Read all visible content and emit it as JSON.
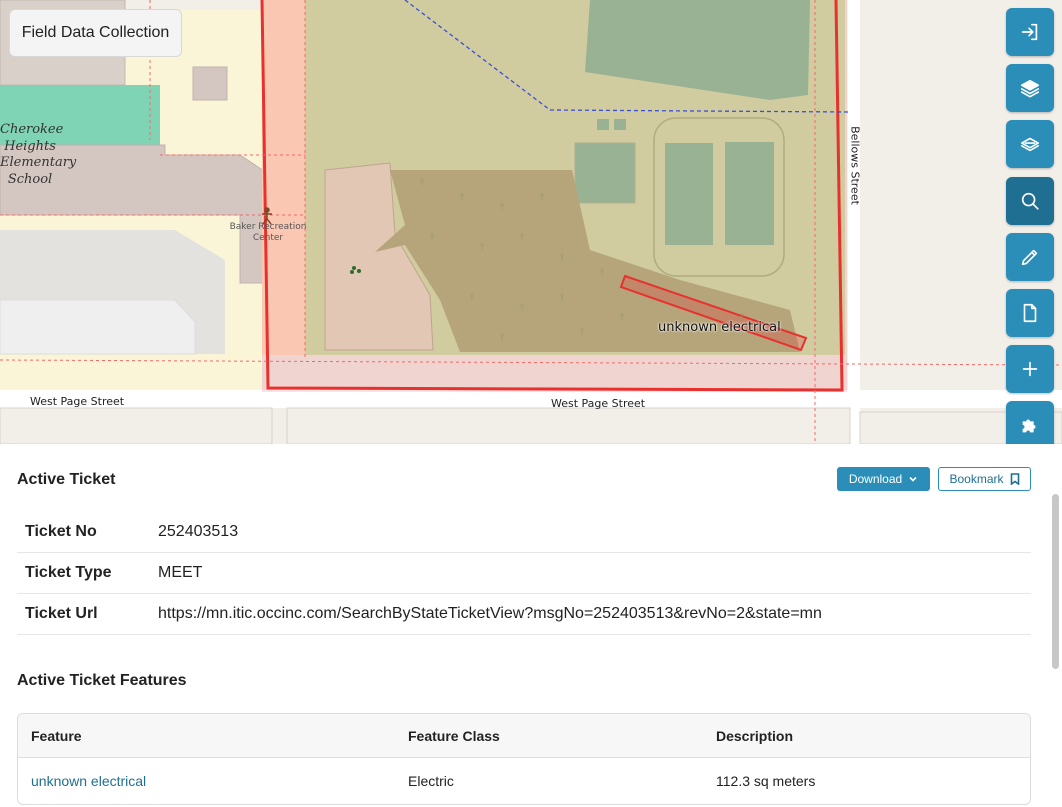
{
  "app": {
    "title": "Field Data Collection"
  },
  "map": {
    "labels": {
      "school": "Cherokee Heights Elementary School",
      "school_lines": [
        "Cherokee",
        "Heights",
        "Elementary",
        "School"
      ],
      "baker": "Baker Recreation Center",
      "baker_lines": [
        "Baker Recreation",
        "Center"
      ],
      "west_page_1": "West Page Street",
      "west_page_2": "West Page Street",
      "bellows": "Bellows Street",
      "feature": "unknown electrical"
    },
    "toolbar": [
      {
        "name": "logout-button",
        "icon": "logout-icon"
      },
      {
        "name": "layers-button",
        "icon": "layers-icon"
      },
      {
        "name": "layers-outline-button",
        "icon": "layers-outline-icon"
      },
      {
        "name": "search-button",
        "icon": "search-icon",
        "active": true
      },
      {
        "name": "edit-button",
        "icon": "pencil-icon"
      },
      {
        "name": "document-button",
        "icon": "document-icon"
      },
      {
        "name": "add-button",
        "icon": "plus-icon"
      },
      {
        "name": "tools-button",
        "icon": "puzzle-icon"
      }
    ],
    "colors": {
      "ticket_boundary": "#e8312f",
      "park": "#cde5b3",
      "woods": "#aeb987",
      "water_feature": "#8cc8a3"
    }
  },
  "active_ticket": {
    "title": "Active Ticket",
    "download_label": "Download",
    "bookmark_label": "Bookmark",
    "rows": [
      {
        "key": "Ticket No",
        "value": "252403513"
      },
      {
        "key": "Ticket Type",
        "value": "MEET"
      },
      {
        "key": "Ticket Url",
        "value": "https://mn.itic.occinc.com/SearchByStateTicketView?msgNo=252403513&revNo=2&state=mn"
      }
    ]
  },
  "features": {
    "title": "Active Ticket Features",
    "columns": [
      "Feature",
      "Feature Class",
      "Description"
    ],
    "rows": [
      {
        "feature": "unknown electrical",
        "feature_class": "Electric",
        "description": "112.3 sq meters"
      }
    ]
  },
  "colors": {
    "accent": "#2a8eb8",
    "accent_dark": "#1f6f93"
  }
}
